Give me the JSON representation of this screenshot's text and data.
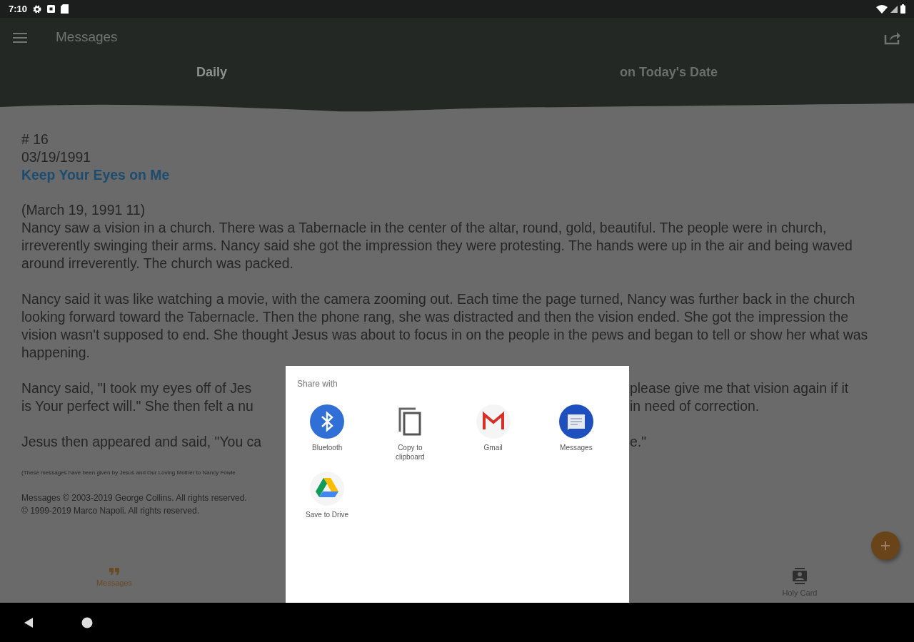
{
  "status_bar": {
    "time": "7:10"
  },
  "app_bar": {
    "title": "Messages"
  },
  "tabs": [
    {
      "label": "Daily",
      "selected": true
    },
    {
      "label": "on Today's Date",
      "selected": false
    }
  ],
  "message": {
    "number": "# 16",
    "date": "03/19/1991",
    "title": "Keep Your Eyes on Me",
    "paragraphs": [
      {
        "kind": "text",
        "lines": [
          "(March 19, 1991 11)",
          "Nancy saw a vision in a church. There was a Tabernacle in the center of the altar, round, gold, beautiful. The people were in church, irreverently swinging their arms. Nancy said she got the impression they were protesting. The hands were up in the air and being waved around irreverently. The church was packed."
        ]
      },
      {
        "kind": "text",
        "lines": [
          "Nancy said it was like watching a movie, with the camera zooming out. Each time the page turned, Nancy was further back in the church looking forward toward the Tabernacle. Then the phone rang, she was distracted and then the vision ended. She got the impression the vision wasn't supposed to end. She thought Jesus was about to focus in on the people in the pews and began to tell or show her what was happening."
        ]
      },
      {
        "kind": "split",
        "parts": [
          {
            "left": "Nancy said, \"I took my eyes off of Jes",
            "right": "please give me that vision again if it"
          },
          {
            "left": "is Your perfect will.\" She then felt a nu",
            "right": "in need of correction."
          }
        ]
      },
      {
        "kind": "split",
        "parts": [
          {
            "left": "Jesus then appeared and said, \"You ca",
            "right": "e.\""
          }
        ]
      },
      {
        "kind": "fine",
        "lines": [
          "(These messages have been given by Jesus and Our Loving Mother to Nancy Fowle"
        ]
      },
      {
        "kind": "copyright",
        "lines": [
          "Messages © 2003-2019 George Collins. All rights reserved.",
          "© 1999-2019 Marco Napoli. All rights reserved."
        ]
      }
    ]
  },
  "bottom_nav": [
    {
      "label": "Messages",
      "kind": "quote",
      "selected": true
    },
    {
      "label": "Holy Card",
      "kind": "card",
      "selected": false
    }
  ],
  "share_dialog": {
    "title": "Share with",
    "targets": [
      {
        "label": "Bluetooth",
        "kind": "bluetooth"
      },
      {
        "label": "Copy to clipboard",
        "kind": "copy"
      },
      {
        "label": "Gmail",
        "kind": "gmail"
      },
      {
        "label": "Messages",
        "kind": "messages"
      },
      {
        "label": "Save to Drive",
        "kind": "drive"
      }
    ]
  }
}
